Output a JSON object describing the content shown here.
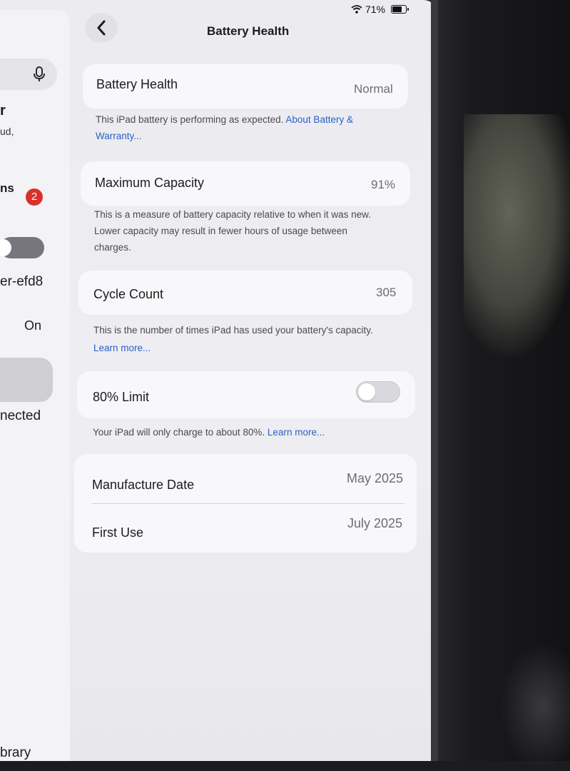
{
  "status_bar": {
    "battery_percent": "71%"
  },
  "nav": {
    "title": "Battery Health"
  },
  "sidebar": {
    "frag_r": "r",
    "frag_ud": "ud,",
    "frag_ns": "ns",
    "badge": "2",
    "frag_efd8": "er-efd8",
    "frag_on": "On",
    "frag_nected": "nected",
    "frag_brary": "brary"
  },
  "battery_health": {
    "label": "Battery Health",
    "value": "Normal",
    "footnote": "This iPad battery is performing as expected.",
    "link": "About Battery & Warranty..."
  },
  "maximum_capacity": {
    "label": "Maximum Capacity",
    "value": "91%",
    "footnote_line1": "This is a measure of battery capacity relative to when it was new.",
    "footnote_line2": "Lower capacity may result in fewer hours of usage between",
    "footnote_line3": "charges."
  },
  "cycle_count": {
    "label": "Cycle Count",
    "value": "305",
    "footnote": "This is the number of times iPad has used your battery's capacity.",
    "link": "Learn more..."
  },
  "limit_80": {
    "label": "80% Limit",
    "enabled": false,
    "footnote": "Your iPad will only charge to about 80%.",
    "link": "Learn more..."
  },
  "dates": {
    "manufacture_label": "Manufacture Date",
    "manufacture_value": "May 2025",
    "first_use_label": "First Use",
    "first_use_value": "July 2025"
  }
}
